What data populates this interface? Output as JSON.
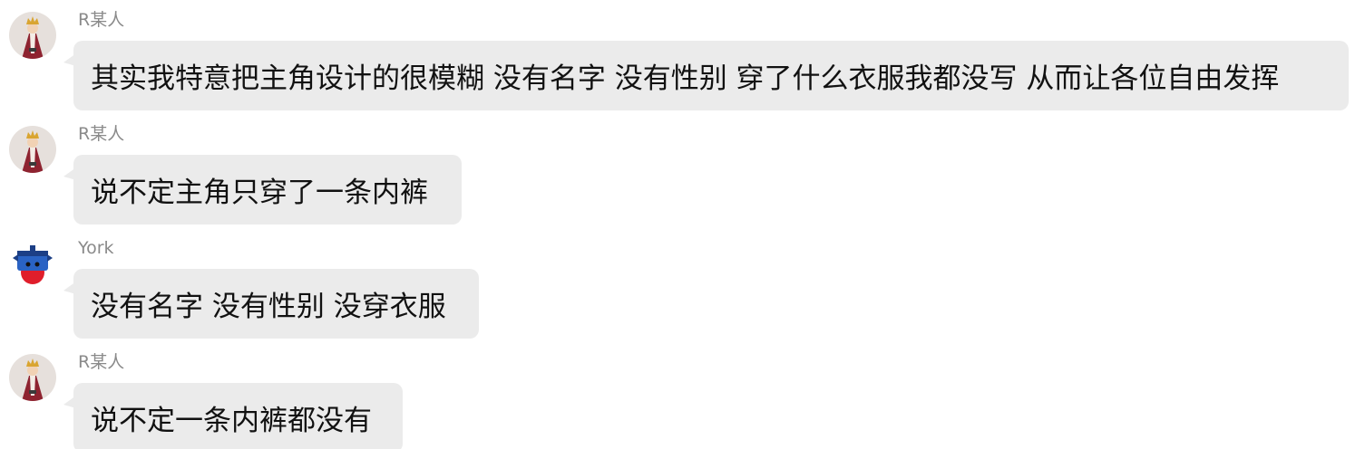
{
  "messages": [
    {
      "sender": "R某人",
      "avatar_icon": "king-avatar-icon",
      "text": "其实我特意把主角设计的很模糊 没有名字 没有性别 穿了什么衣服我都没写 从而让各位自由发挥"
    },
    {
      "sender": "R某人",
      "avatar_icon": "king-avatar-icon",
      "text": "说不定主角只穿了一条内裤"
    },
    {
      "sender": "York",
      "avatar_icon": "cartoon-character-avatar-icon",
      "text": "没有名字 没有性别 没穿衣服"
    },
    {
      "sender": "R某人",
      "avatar_icon": "king-avatar-icon",
      "text": "说不定一条内裤都没有"
    }
  ],
  "colors": {
    "bubble_bg": "#ebebeb",
    "sender_text": "#8a8a8a",
    "message_text": "#111111",
    "background": "#ffffff"
  }
}
